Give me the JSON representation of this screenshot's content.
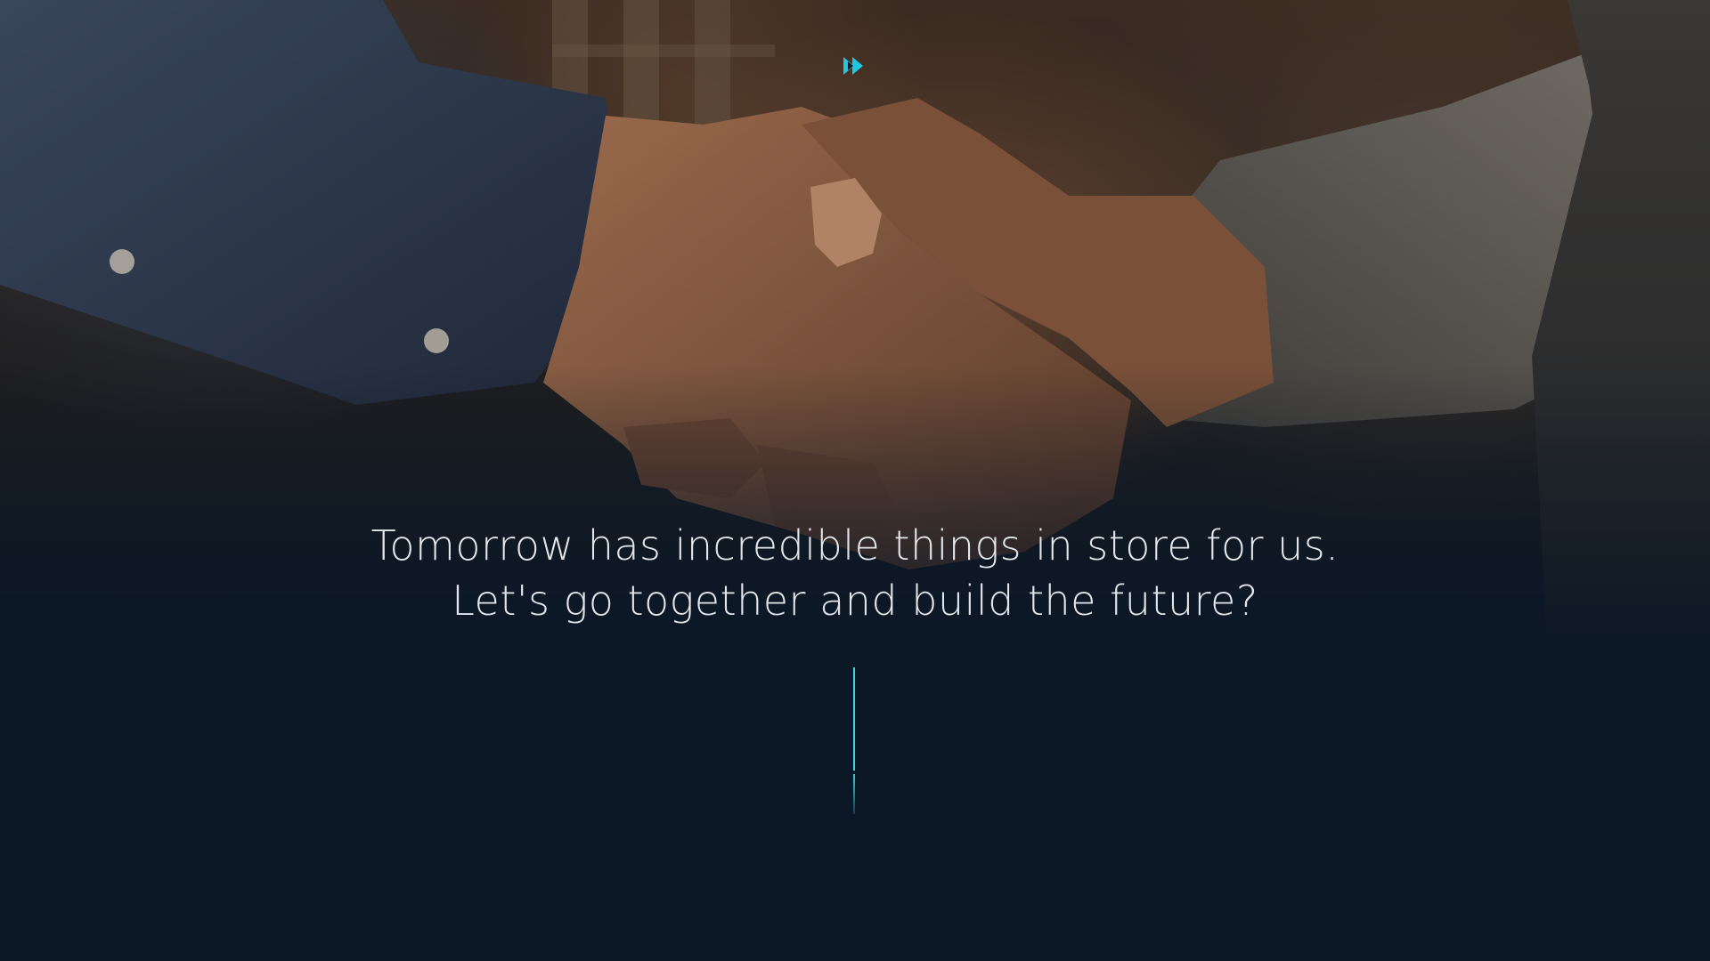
{
  "hero": {
    "line1": "Tomorrow has incredible things in store for us.",
    "line2": "Let's go together and build the future?"
  },
  "icons": {
    "logo": "fast-forward-icon",
    "scroll": "scroll-indicator-line"
  },
  "colors": {
    "accent": "#1fc8e0",
    "background": "#0c1826",
    "text": "#e3e6ea"
  }
}
